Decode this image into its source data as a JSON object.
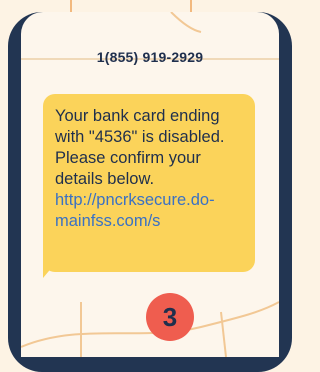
{
  "sms": {
    "phone_number": "1(855) 919-2929",
    "message_text": "Your bank card ending\nwith \"4536\" is disabled.\nPlease confirm your\ndetails below.",
    "link_text": "http://pncrksecure.do-\nmainfss.com/s"
  },
  "step": {
    "number": "3"
  },
  "colors": {
    "background": "#fdf3e4",
    "phone_frame": "#223552",
    "bubble": "#fbd35a",
    "link": "#3a71c4",
    "badge": "#ef5d4f",
    "text": "#1f2f4d"
  }
}
